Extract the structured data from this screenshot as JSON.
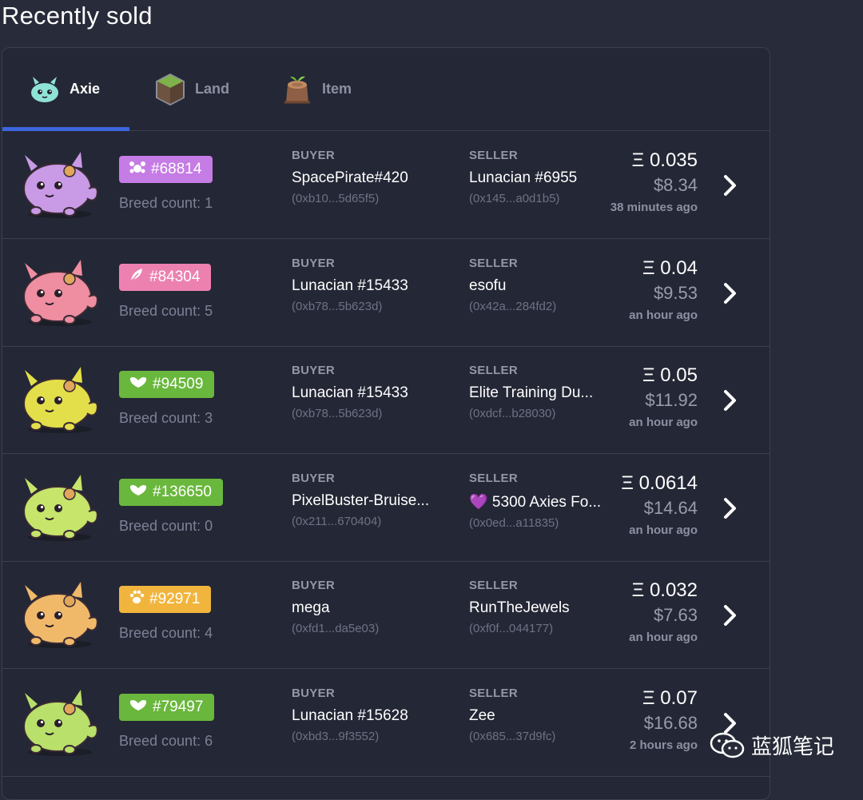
{
  "page": {
    "title": "Recently sold"
  },
  "tabs": [
    {
      "label": "Axie",
      "active": true
    },
    {
      "label": "Land",
      "active": false
    },
    {
      "label": "Item",
      "active": false
    }
  ],
  "labels": {
    "buyer": "BUYER",
    "seller": "SELLER"
  },
  "colors": {
    "accent": "#3d66de",
    "bug": "#c57ce4",
    "bird": "#ec81b0",
    "plant": "#6ab73d",
    "beast": "#f1b53e"
  },
  "sales": [
    {
      "axie_class": "bug",
      "class_icon": "bug-icon",
      "badge_color": "#c57ce4",
      "body_color": "#c99ae6",
      "id": "#68814",
      "breed": "Breed count: 1",
      "buyer_name": "SpacePirate#420",
      "buyer_addr": "(0xb10...5d65f5)",
      "seller_name": "Lunacian #6955",
      "seller_addr": "(0x145...a0d1b5)",
      "eth": "Ξ 0.035",
      "usd": "$8.34",
      "time": "38 minutes ago"
    },
    {
      "axie_class": "bird",
      "class_icon": "feather-icon",
      "badge_color": "#ec81b0",
      "body_color": "#ef8ea1",
      "id": "#84304",
      "breed": "Breed count: 5",
      "buyer_name": "Lunacian #15433",
      "buyer_addr": "(0xb78...5b623d)",
      "seller_name": "esofu",
      "seller_addr": "(0x42a...284fd2)",
      "eth": "Ξ 0.04",
      "usd": "$9.53",
      "time": "an hour ago"
    },
    {
      "axie_class": "plant",
      "class_icon": "leaf-icon",
      "badge_color": "#6ab73d",
      "body_color": "#e3df4a",
      "id": "#94509",
      "breed": "Breed count: 3",
      "buyer_name": "Lunacian #15433",
      "buyer_addr": "(0xb78...5b623d)",
      "seller_name": "Elite Training Du...",
      "seller_addr": "(0xdcf...b28030)",
      "eth": "Ξ 0.05",
      "usd": "$11.92",
      "time": "an hour ago"
    },
    {
      "axie_class": "plant",
      "class_icon": "leaf-icon",
      "badge_color": "#6ab73d",
      "body_color": "#c6e56a",
      "id": "#136650",
      "breed": "Breed count: 0",
      "buyer_name": "PixelBuster-Bruise...",
      "buyer_addr": "(0x211...670404)",
      "seller_name": "💜 5300 Axies Fo...",
      "seller_addr": "(0x0ed...a11835)",
      "eth": "Ξ 0.0614",
      "usd": "$14.64",
      "time": "an hour ago"
    },
    {
      "axie_class": "beast",
      "class_icon": "paw-icon",
      "badge_color": "#f1b53e",
      "body_color": "#f0b96a",
      "id": "#92971",
      "breed": "Breed count: 4",
      "buyer_name": "mega",
      "buyer_addr": "(0xfd1...da5e03)",
      "seller_name": "RunTheJewels",
      "seller_addr": "(0xf0f...044177)",
      "eth": "Ξ 0.032",
      "usd": "$7.63",
      "time": "an hour ago"
    },
    {
      "axie_class": "plant",
      "class_icon": "leaf-icon",
      "badge_color": "#6ab73d",
      "body_color": "#b9e06a",
      "id": "#79497",
      "breed": "Breed count: 6",
      "buyer_name": "Lunacian #15628",
      "buyer_addr": "(0xbd3...9f3552)",
      "seller_name": "Zee",
      "seller_addr": "(0x685...37d9fc)",
      "eth": "Ξ 0.07",
      "usd": "$16.68",
      "time": "2 hours ago"
    }
  ],
  "watermark": {
    "text": "蓝狐笔记",
    "icon": "wechat-icon"
  }
}
